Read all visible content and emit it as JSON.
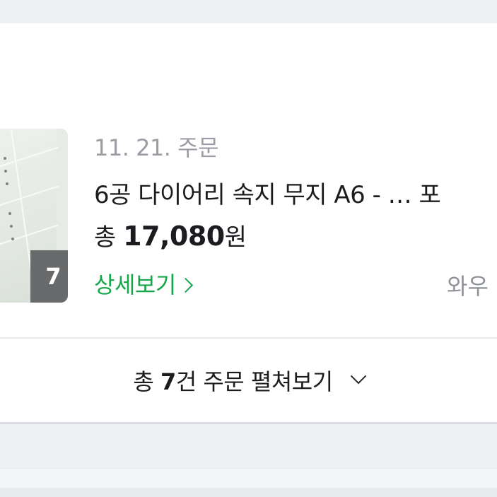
{
  "order": {
    "date": "11. 21. 주문",
    "product_name": "6공 다이어리 속지 무지 A6 - …  포",
    "total_prefix": "총 ",
    "total_amount": "17,080",
    "total_suffix": "원",
    "details_link": "상세보기",
    "delivery_partial": "와우",
    "thumbnail_count": "7"
  },
  "expand": {
    "prefix": "총 ",
    "count": "7",
    "suffix": "건 주문 펼쳐보기"
  },
  "icons": {
    "details_chevron": "chevron-right-icon",
    "expand_chevron": "chevron-down-icon"
  },
  "colors": {
    "accent_green": "#17a74a",
    "muted_gray": "#9a9da3",
    "text_dark": "#1b1c1f",
    "page_bg": "#eef0f3"
  }
}
